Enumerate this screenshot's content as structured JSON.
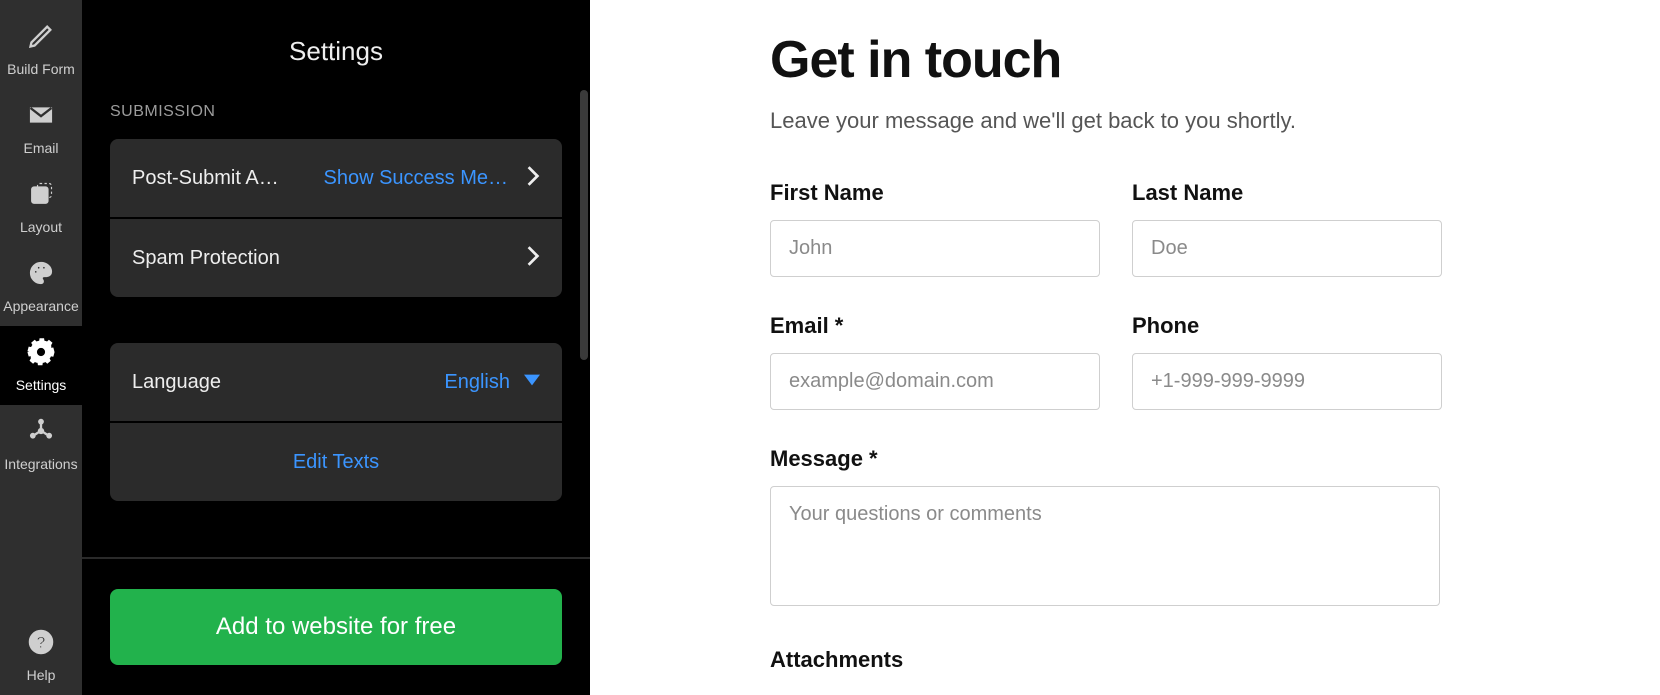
{
  "rail": {
    "items": [
      {
        "id": "build-form",
        "label": "Build Form"
      },
      {
        "id": "email",
        "label": "Email"
      },
      {
        "id": "layout",
        "label": "Layout"
      },
      {
        "id": "appearance",
        "label": "Appearance"
      },
      {
        "id": "settings",
        "label": "Settings"
      },
      {
        "id": "integrations",
        "label": "Integrations"
      }
    ],
    "help_label": "Help"
  },
  "panel": {
    "title": "Settings",
    "section_submission": "SUBMISSION",
    "post_submit_label": "Post-Submit A…",
    "post_submit_value": "Show Success Me…",
    "spam_label": "Spam Protection",
    "language_label": "Language",
    "language_value": "English",
    "edit_texts": "Edit Texts",
    "cta": "Add to website for free"
  },
  "form": {
    "title": "Get in touch",
    "description": "Leave your message and we'll get back to you shortly.",
    "first_name_label": "First Name",
    "first_name_ph": "John",
    "last_name_label": "Last Name",
    "last_name_ph": "Doe",
    "email_label": "Email *",
    "email_ph": "example@domain.com",
    "phone_label": "Phone",
    "phone_ph": "+1-999-999-9999",
    "message_label": "Message *",
    "message_ph": "Your questions or comments",
    "attachments_label": "Attachments"
  }
}
